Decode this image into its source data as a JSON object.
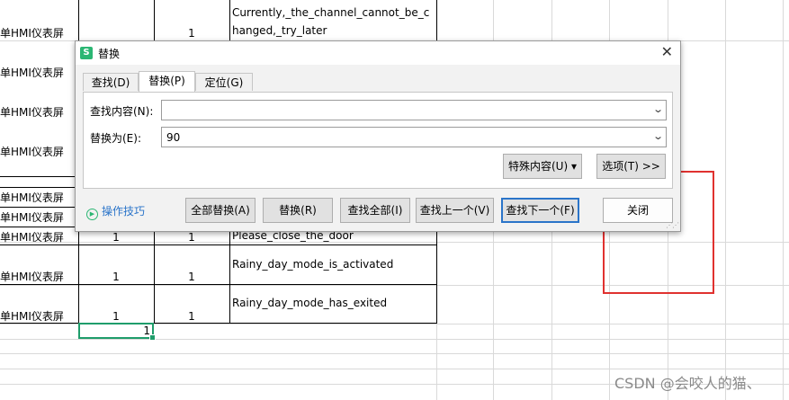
{
  "sheet": {
    "rows": [
      {
        "a": "单HMI仪表屏",
        "b": "1",
        "c": "1",
        "text": "Currently,_the_channel_cannot_be_changed,_try_later"
      },
      {
        "a": "单HMI仪表屏"
      },
      {
        "a": "单HMI仪表屏"
      },
      {
        "a": "单HMI仪表屏"
      },
      {
        "a": "单HMI仪表屏"
      },
      {
        "a": "单HMI仪表屏"
      },
      {
        "a": "单HMI仪表屏"
      },
      {
        "a": "单HMI仪表屏",
        "b": "1",
        "c": "1",
        "text": "Please_close_the_door"
      },
      {
        "a": "单HMI仪表屏",
        "b": "1",
        "c": "1",
        "text": "Rainy_day_mode_is_activated"
      },
      {
        "a": "单HMI仪表屏",
        "b": "1",
        "c": "1",
        "text": "Rainy_day_mode_has_exited"
      }
    ],
    "selected_value": "1",
    "watermark": "CSDN @会咬人的猫、"
  },
  "dialog": {
    "title": "替换",
    "app_icon": "S",
    "close_glyph": "✕",
    "tabs": [
      {
        "label": "查找(D)"
      },
      {
        "label": "替换(P)"
      },
      {
        "label": "定位(G)"
      }
    ],
    "find_label": "查找内容(N):",
    "find_value": "",
    "replace_label": "替换为(E):",
    "replace_value": "90",
    "special_button": "特殊内容(U) ▾",
    "options_button": "选项(T) >>",
    "tips_link": "操作技巧",
    "buttons": {
      "replace_all": "全部替换(A)",
      "replace": "替换(R)",
      "find_all": "查找全部(I)",
      "find_prev": "查找上一个(V)",
      "find_next": "查找下一个(F)",
      "close": "关闭"
    }
  }
}
